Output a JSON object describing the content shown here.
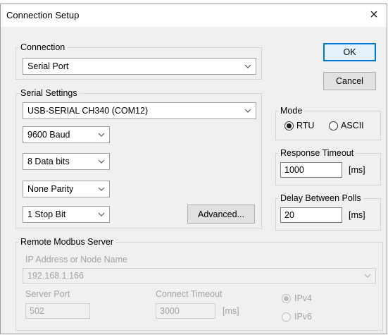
{
  "window": {
    "title": "Connection Setup",
    "close_glyph": "×"
  },
  "connection": {
    "group_label": "Connection",
    "selected": "Serial Port"
  },
  "buttons": {
    "ok": "OK",
    "cancel": "Cancel",
    "advanced": "Advanced..."
  },
  "serial": {
    "group_label": "Serial Settings",
    "port": "USB-SERIAL CH340 (COM12)",
    "baud": "9600 Baud",
    "data_bits": "8 Data bits",
    "parity": "None Parity",
    "stop_bits": "1 Stop Bit"
  },
  "mode": {
    "group_label": "Mode",
    "rtu": "RTU",
    "ascii": "ASCII",
    "selected": "RTU"
  },
  "response": {
    "group_label": "Response Timeout",
    "value": "1000",
    "unit": "[ms]"
  },
  "delay": {
    "group_label": "Delay Between Polls",
    "value": "20",
    "unit": "[ms]"
  },
  "remote": {
    "group_label": "Remote Modbus Server",
    "ip_label": "IP Address or Node Name",
    "ip_value": "192.168.1.166",
    "port_label": "Server Port",
    "port_value": "502",
    "timeout_label": "Connect Timeout",
    "timeout_value": "3000",
    "timeout_unit": "[ms]",
    "ipv4": "IPv4",
    "ipv6": "IPv6",
    "selected": "IPv4"
  },
  "icons": {
    "close": "close-icon",
    "dropdown": "chevron-down-icon"
  },
  "colors": {
    "default_button_border": "#0078d7",
    "dialog_bg": "#f0f0f0",
    "disabled_text": "#a3a3a3"
  }
}
